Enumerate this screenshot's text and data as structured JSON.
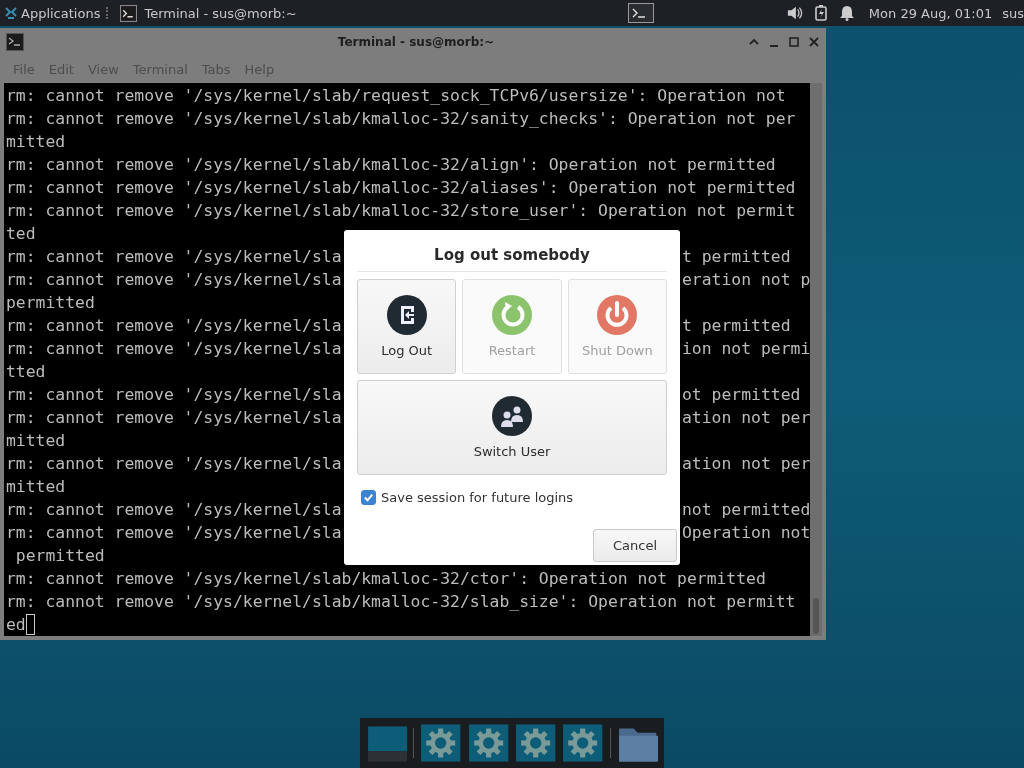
{
  "top_panel": {
    "menu": "Applications",
    "tasks": [
      {
        "title": "Terminal - sus@morb:~"
      }
    ],
    "clock": "Mon 29 Aug, 01:01",
    "user": "sus"
  },
  "terminal_window": {
    "title": "Terminal - sus@morb:~",
    "menu": [
      "File",
      "Edit",
      "View",
      "Terminal",
      "Tabs",
      "Help"
    ],
    "lines": [
      {
        "text": "rm: cannot remove '/sys/kernel/slab/request_sock_TCPv6/usersize': Operation not"
      },
      {
        "text": "rm: cannot remove '/sys/kernel/slab/kmalloc-32/sanity_checks': Operation not per"
      },
      {
        "text": "mitted"
      },
      {
        "text": "rm: cannot remove '/sys/kernel/slab/kmalloc-32/align': Operation not permitted"
      },
      {
        "text": "rm: cannot remove '/sys/kernel/slab/kmalloc-32/aliases': Operation not permitted"
      },
      {
        "text": "rm: cannot remove '/sys/kernel/slab/kmalloc-32/store_user': Operation not permit"
      },
      {
        "text": "ted"
      },
      {
        "text": "rm: cannot remove '/sys/kernel/sla",
        "right_text": "t permitted"
      },
      {
        "text": "rm: cannot remove '/sys/kernel/sla",
        "right_text": "eration not p"
      },
      {
        "text": "permitted"
      },
      {
        "text": "rm: cannot remove '/sys/kernel/sla",
        "right_text": "t permitted"
      },
      {
        "text": "rm: cannot remove '/sys/kernel/sla",
        "right_text": "ion not permi"
      },
      {
        "text": "tted"
      },
      {
        "text": "rm: cannot remove '/sys/kernel/sla",
        "right_text": "ot permitted"
      },
      {
        "text": "rm: cannot remove '/sys/kernel/sla",
        "right_text": "ation not per"
      },
      {
        "text": "mitted"
      },
      {
        "text": "rm: cannot remove '/sys/kernel/sla",
        "right_text": "ation not per"
      },
      {
        "text": "mitted"
      },
      {
        "text": "rm: cannot remove '/sys/kernel/sla",
        "right_text": "not permitted"
      },
      {
        "text": "rm: cannot remove '/sys/kernel/sla",
        "right_text": "Operation not"
      },
      {
        "text": " permitted"
      },
      {
        "text": "rm: cannot remove '/sys/kernel/slab/kmalloc-32/ctor': Operation not permitted"
      },
      {
        "text": "rm: cannot remove '/sys/kernel/slab/kmalloc-32/slab_size': Operation not permitt"
      },
      {
        "text": "ed",
        "cursor": true
      }
    ]
  },
  "dialog": {
    "title": "Log out somebody",
    "actions": [
      {
        "kind": "logout",
        "label": "Log Out",
        "disabled": false
      },
      {
        "kind": "restart",
        "label": "Restart",
        "disabled": true
      },
      {
        "kind": "shutdown",
        "label": "Shut Down",
        "disabled": true
      },
      {
        "kind": "switch",
        "label": "Switch User",
        "disabled": false
      }
    ],
    "save_session": {
      "label": "Save session for future logins",
      "checked": true
    },
    "cancel": "Cancel"
  }
}
